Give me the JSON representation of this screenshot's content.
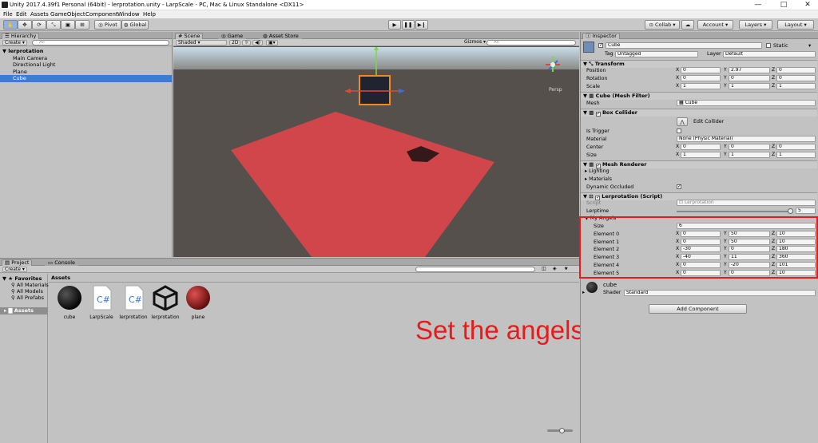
{
  "window": {
    "title": "Unity 2017.4.39f1 Personal (64bit) - lerprotation.unity - LarpScale - PC, Mac & Linux Standalone <DX11>",
    "min": "—",
    "max": "□",
    "close": "✕"
  },
  "menu": [
    "File",
    "Edit",
    "Assets",
    "GameObject",
    "Component",
    "Window",
    "Help"
  ],
  "toolbar": {
    "pivot": "Pivot",
    "global": "Global",
    "collab": "Collab",
    "account": "Account",
    "layers": "Layers",
    "layout": "Layout"
  },
  "hierarchy": {
    "tab": "Hierarchy",
    "create": "Create",
    "search": "All",
    "scene": "lerprotation",
    "items": [
      "Main Camera",
      "Directional Light",
      "Plane",
      "Cube"
    ],
    "selected": "Cube"
  },
  "scene": {
    "tabs": [
      "Scene",
      "Game",
      "Asset Store"
    ],
    "shading": "Shaded",
    "mode2d": "2D",
    "gizmos": "Gizmos",
    "search": "All",
    "persp": "Persp"
  },
  "project": {
    "tabs": [
      "Project",
      "Console"
    ],
    "create": "Create",
    "favorites": "Favorites",
    "fav_items": [
      "All Materials",
      "All Models",
      "All Prefabs"
    ],
    "assets_folder": "Assets",
    "assets_header": "Assets",
    "assets": [
      {
        "name": "cube",
        "kind": "sphere-black"
      },
      {
        "name": "LarpScale",
        "kind": "script"
      },
      {
        "name": "lerprotation",
        "kind": "script"
      },
      {
        "name": "lerprotation",
        "kind": "unity"
      },
      {
        "name": "plane",
        "kind": "sphere-red"
      }
    ]
  },
  "inspector": {
    "tab": "Inspector",
    "object_name": "Cube",
    "static": "Static",
    "tag_label": "Tag",
    "tag": "Untagged",
    "layer_label": "Layer",
    "layer": "Default",
    "transform": {
      "title": "Transform",
      "rows": [
        {
          "label": "Position",
          "x": "0",
          "y": "2.97",
          "z": "0"
        },
        {
          "label": "Rotation",
          "x": "0",
          "y": "0",
          "z": "0"
        },
        {
          "label": "Scale",
          "x": "1",
          "y": "1",
          "z": "1"
        }
      ]
    },
    "mesh_filter": {
      "title": "Cube (Mesh Filter)",
      "mesh_label": "Mesh",
      "mesh": "Cube"
    },
    "box_collider": {
      "title": "Box Collider",
      "edit": "Edit Collider",
      "is_trigger": "Is Trigger",
      "material_label": "Material",
      "material": "None (Physic Material)",
      "center_label": "Center",
      "center": {
        "x": "0",
        "y": "0",
        "z": "0"
      },
      "size_label": "Size",
      "size": {
        "x": "1",
        "y": "1",
        "z": "1"
      }
    },
    "mesh_renderer": {
      "title": "Mesh Renderer",
      "lighting": "Lighting",
      "materials": "Materials",
      "dynamic_occluded": "Dynamic Occluded"
    },
    "lerp_script": {
      "title": "Lerprotation (Script)",
      "script_label": "Script",
      "script": "Lerprotation",
      "lerptime_label": "Lerptime",
      "lerptime": "5",
      "lerptime_fraction": 0.97,
      "angles_label": "My Angels",
      "size_label": "Size",
      "size": "6",
      "elements": [
        {
          "label": "Element 0",
          "x": "0",
          "y": "50",
          "z": "10"
        },
        {
          "label": "Element 1",
          "x": "0",
          "y": "50",
          "z": "10"
        },
        {
          "label": "Element 2",
          "x": "-30",
          "y": "0",
          "z": "180"
        },
        {
          "label": "Element 3",
          "x": "-40",
          "y": "11",
          "z": "360"
        },
        {
          "label": "Element 4",
          "x": "0",
          "y": "-20",
          "z": "101"
        },
        {
          "label": "Element 5",
          "x": "0",
          "y": "0",
          "z": "10"
        }
      ]
    },
    "material": {
      "name": "cube",
      "shader_label": "Shader",
      "shader": "Standard"
    },
    "add_component": "Add Component"
  },
  "annotation": {
    "text": "Set the angels  lerprotation",
    "color": "#e81a1a"
  },
  "axes": {
    "x": "X",
    "y": "Y",
    "z": "Z"
  },
  "colors": {
    "selection": "#3d7bd6",
    "plane": "#d0464b",
    "highlight_box": "#e81a1a",
    "ground": "#56504c",
    "sky": "#b8d0dd"
  }
}
